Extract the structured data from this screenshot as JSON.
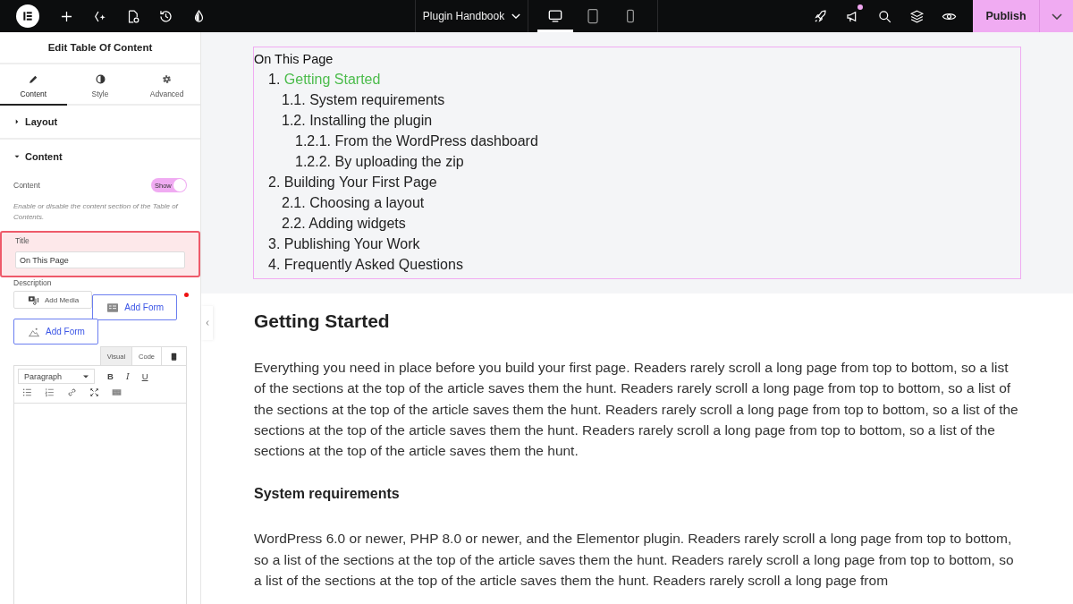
{
  "topbar": {
    "page_title": "Plugin Handbook",
    "devices": [
      {
        "kind": "desktop",
        "selected": true
      },
      {
        "kind": "tablet",
        "selected": false
      },
      {
        "kind": "mobile",
        "selected": false
      }
    ],
    "actions": [
      {
        "kind": "rocket",
        "badge": false
      },
      {
        "kind": "megaphone",
        "badge": true
      },
      {
        "kind": "search",
        "badge": false
      },
      {
        "kind": "layers",
        "badge": false
      },
      {
        "kind": "eye",
        "badge": false
      }
    ],
    "publish": "Publish"
  },
  "panel": {
    "title": "Edit Table Of Content",
    "tabs": [
      {
        "kind": "pencil",
        "label": "Content",
        "selected": true
      },
      {
        "kind": "contrast",
        "label": "Style",
        "selected": false
      },
      {
        "kind": "gear",
        "label": "Advanced",
        "selected": false
      }
    ],
    "sections": [
      {
        "label": "Layout",
        "expanded": false
      },
      {
        "label": "Content",
        "expanded": true
      }
    ],
    "toggle": {
      "label": "Content",
      "text": "Show",
      "on": true
    },
    "hint": "Enable or disable the content section of the Table of Contents.",
    "title_field": {
      "label": "Title",
      "value": "On This Page",
      "highlighted": true
    },
    "description_label": "Description",
    "media_buttons": [
      {
        "kind": "media",
        "label": "Add Media",
        "primary": false
      },
      {
        "kind": "form",
        "label": "Add Form",
        "primary": true
      },
      {
        "kind": "image",
        "label": "Add Form",
        "primary": true
      }
    ],
    "unsaved_dot": true,
    "editor_tabs": [
      {
        "label": "Visual",
        "selected": true
      },
      {
        "label": "Code",
        "selected": false
      }
    ],
    "format": "Paragraph",
    "format_buttons": [
      "B",
      "I",
      "U"
    ]
  },
  "toc": {
    "title": "On This Page",
    "items": [
      {
        "number": "1.",
        "label": "Getting Started",
        "selected": true,
        "children": [
          {
            "number": "1.1.",
            "label": "System requirements",
            "selected": false
          },
          {
            "number": "1.2.",
            "label": "Installing the plugin",
            "selected": false,
            "children": [
              {
                "number": "1.2.1.",
                "label": "From the WordPress dashboard",
                "selected": false
              },
              {
                "number": "1.2.2.",
                "label": "By uploading the zip",
                "selected": false
              }
            ]
          }
        ]
      },
      {
        "number": "2.",
        "label": "Building Your First Page",
        "selected": false,
        "children": [
          {
            "number": "2.1.",
            "label": "Choosing a layout",
            "selected": false
          },
          {
            "number": "2.2.",
            "label": "Adding widgets",
            "selected": false
          }
        ]
      },
      {
        "number": "3.",
        "label": "Publishing Your Work",
        "selected": false
      },
      {
        "number": "4.",
        "label": "Frequently Asked Questions",
        "selected": false
      }
    ]
  },
  "article": [
    {
      "kind": "h2",
      "text": "Getting Started"
    },
    {
      "kind": "p",
      "text": "Everything you need in place before you build your first page. Readers rarely scroll a long page from top to bottom, so a list of the sections at the top of the article saves them the hunt. Readers rarely scroll a long page from top to bottom, so a list of the sections at the top of the article saves them the hunt. Readers rarely scroll a long page from top to bottom, so a list of the sections at the top of the article saves them the hunt. Readers rarely scroll a long page from top to bottom, so a list of the sections at the top of the article saves them the hunt."
    },
    {
      "kind": "h3",
      "text": "System requirements"
    },
    {
      "kind": "p",
      "text": "WordPress 6.0 or newer, PHP 8.0 or newer, and the Elementor plugin. Readers rarely scroll a long page from top to bottom, so a list of the sections at the top of the article saves them the hunt. Readers rarely scroll a long page from top to bottom, so a list of the sections at the top of the article saves them the hunt. Readers rarely scroll a long page from"
    }
  ]
}
